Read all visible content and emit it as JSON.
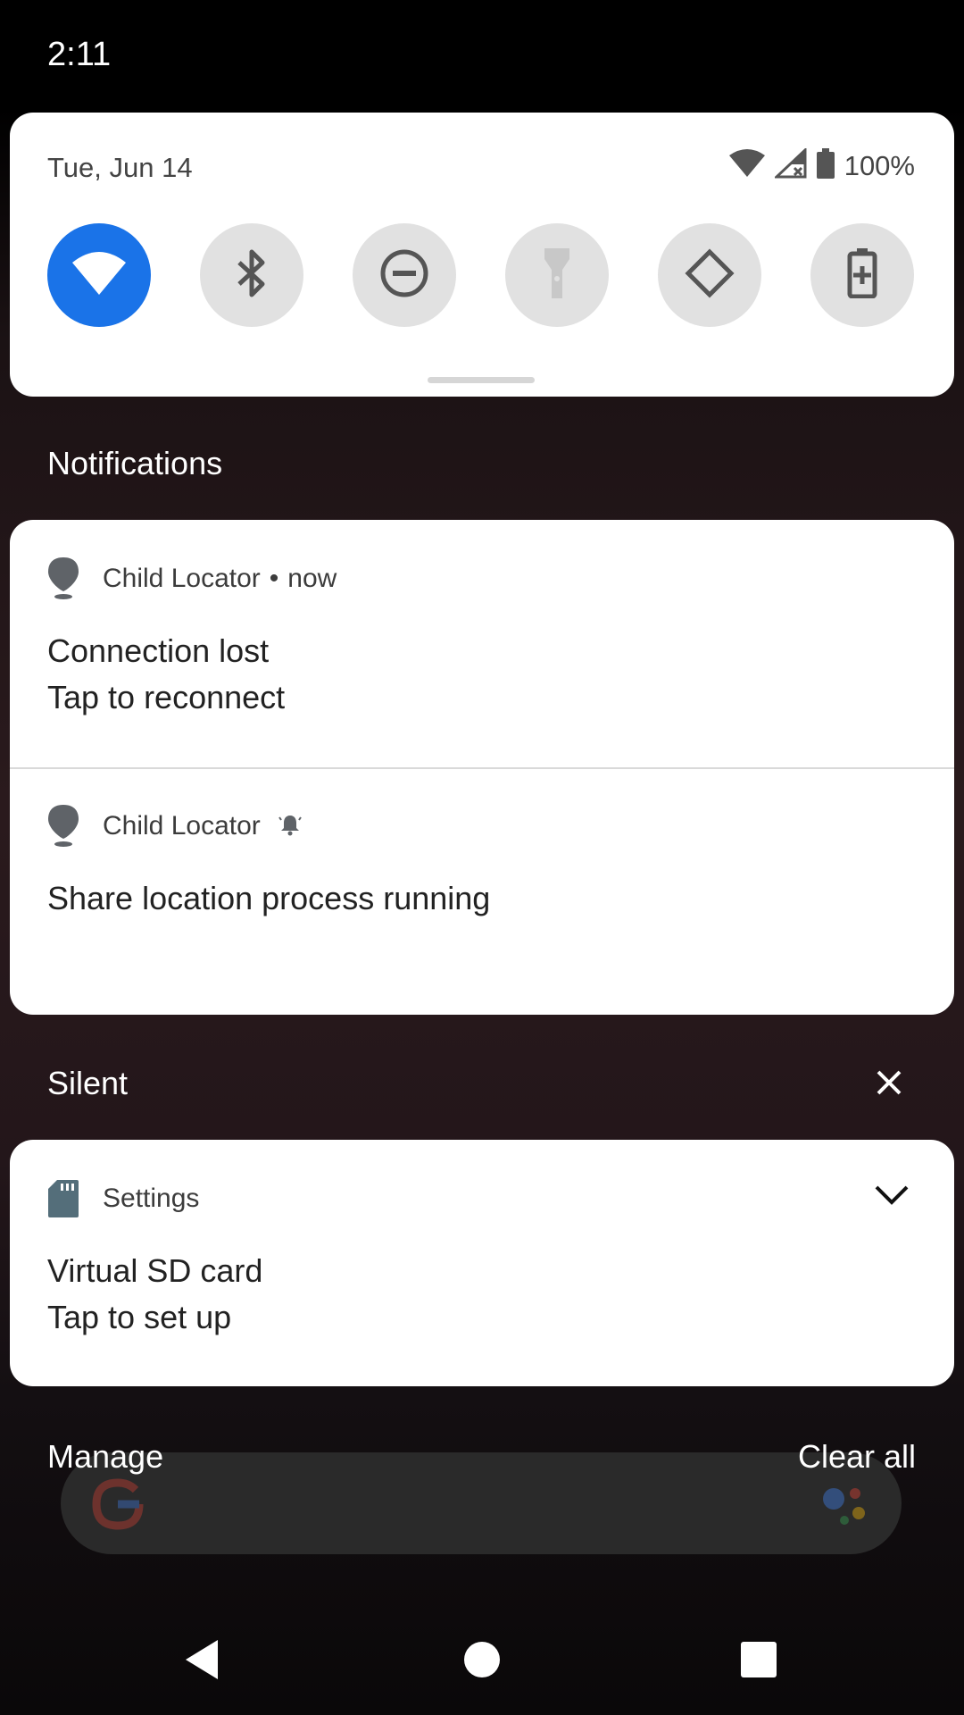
{
  "status_bar": {
    "time": "2:11"
  },
  "quick_settings": {
    "date": "Tue, Jun 14",
    "battery_percent": "100%",
    "accent_color": "#1a73e8",
    "tiles": [
      {
        "icon": "wifi-icon",
        "active": true
      },
      {
        "icon": "bluetooth-icon",
        "active": false
      },
      {
        "icon": "do-not-disturb-icon",
        "active": false
      },
      {
        "icon": "flashlight-icon",
        "active": false
      },
      {
        "icon": "auto-rotate-icon",
        "active": false
      },
      {
        "icon": "battery-saver-icon",
        "active": false
      }
    ]
  },
  "notifications_header": "Notifications",
  "notifications": [
    {
      "app": "Child Locator",
      "separator": "•",
      "time": "now",
      "title": "Connection lost",
      "text": "Tap to reconnect",
      "icon": "location-pin-icon"
    },
    {
      "app": "Child Locator",
      "title": "Share location process running",
      "icon": "location-pin-icon",
      "alert_icon": "bell-icon"
    }
  ],
  "silent_header": "Silent",
  "silent_notifications": [
    {
      "app": "Settings",
      "title": "Virtual SD card",
      "text": "Tap to set up",
      "icon": "sd-card-icon"
    }
  ],
  "footer": {
    "manage": "Manage",
    "clear_all": "Clear all"
  }
}
